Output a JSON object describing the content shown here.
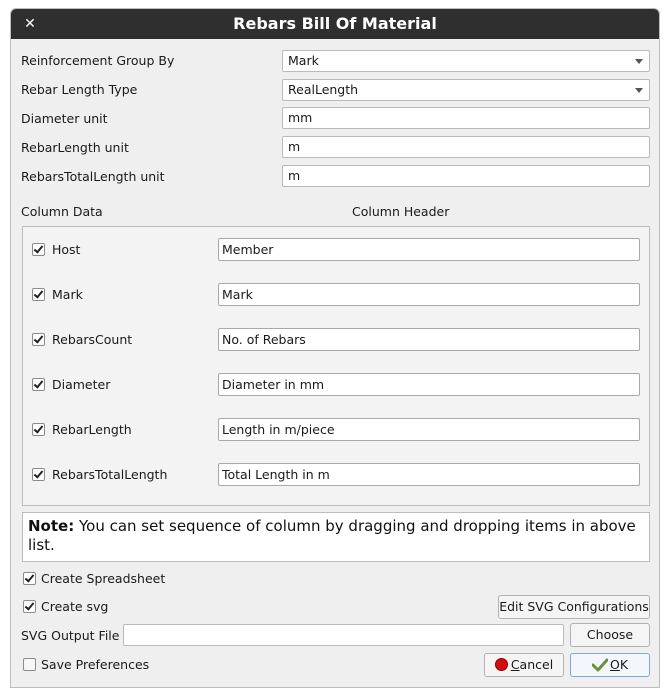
{
  "window": {
    "title": "Rebars Bill Of Material"
  },
  "settings": {
    "group_by": {
      "label": "Reinforcement Group By",
      "value": "Mark"
    },
    "length_type": {
      "label": "Rebar Length Type",
      "value": "RealLength"
    },
    "diameter_unit": {
      "label": "Diameter unit",
      "value": "mm"
    },
    "rebar_length_unit": {
      "label": "RebarLength unit",
      "value": "m"
    },
    "total_length_unit": {
      "label": "RebarsTotalLength unit",
      "value": "m"
    }
  },
  "columns": {
    "data_header": "Column Data",
    "header_header": "Column Header",
    "items": [
      {
        "name": "Host",
        "header": "Member",
        "checked": true
      },
      {
        "name": "Mark",
        "header": "Mark",
        "checked": true
      },
      {
        "name": "RebarsCount",
        "header": "No. of Rebars",
        "checked": true
      },
      {
        "name": "Diameter",
        "header": "Diameter in mm",
        "checked": true
      },
      {
        "name": "RebarLength",
        "header": "Length in m/piece",
        "checked": true
      },
      {
        "name": "RebarsTotalLength",
        "header": "Total Length in m",
        "checked": true
      }
    ]
  },
  "note": {
    "bold": "Note:",
    "text": " You can set sequence of column by dragging and dropping items in above list."
  },
  "options": {
    "create_spreadsheet": {
      "label": "Create Spreadsheet",
      "checked": true
    },
    "create_svg": {
      "label": "Create svg",
      "checked": true
    },
    "edit_svg_button": "Edit SVG Configurations",
    "svg_output_label": "SVG Output File",
    "svg_output_value": "",
    "choose_button": "Choose",
    "save_preferences": {
      "label": "Save Preferences",
      "checked": false
    }
  },
  "buttons": {
    "cancel_mnemonic": "C",
    "cancel_rest": "ancel",
    "ok_mnemonic": "O",
    "ok_rest": "K"
  },
  "colors": {
    "titlebar": "#2f2f2f",
    "cancel_icon": "#d10f0f",
    "ok_icon": "#6b8f3a"
  },
  "icons": {
    "close": "close-icon",
    "cancel": "cancel-icon",
    "ok": "ok-icon",
    "dropdown": "chevron-down-icon"
  }
}
